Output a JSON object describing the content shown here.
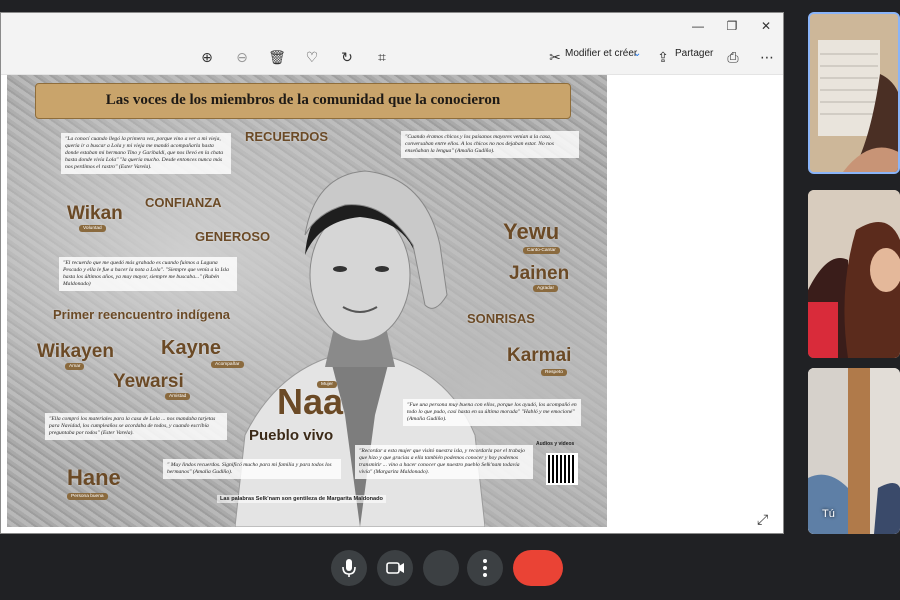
{
  "toolbar": {
    "edit_label": "Modifier et créer",
    "share_label": "Partager"
  },
  "poster": {
    "title": "Las voces de los miembros de la comunidad que la conocieron",
    "words": {
      "recuerdos": "RECUERDOS",
      "confianza": "CONFIANZA",
      "generoso": "GENEROSO",
      "wikan": "Wikan",
      "wikan_tag": "Voluntad",
      "yewu": "Yewu",
      "yewu_tag": "Canto-Cantar",
      "jainen": "Jainen",
      "jainen_tag": "Agradar",
      "primer": "Primer reencuentro indígena",
      "sonrisas": "SONRISAS",
      "wikayen": "Wikayen",
      "wikayen_tag": "Amar",
      "kayne": "Kayne",
      "kayne_tag": "Acompañar",
      "karmai": "Karmai",
      "karmai_tag": "Respeto",
      "yewarsi": "Yewarsi",
      "yewarsi_tag": "Amistad",
      "naa": "Naa",
      "naa_tag": "Mujer",
      "pueblo": "Pueblo vivo",
      "hane": "Hane",
      "hane_tag": "Persona buena"
    },
    "quotes": {
      "q1": "\"La conocí cuando llegó la primera vez, porque vino a ver a mi vieja, quería ir a buscar a Lola y mi vieja me mandó acompañarla hasta donde estaban mi hermano Tino y Garibaldi, que nos llevó en la chata hasta donde vivía Lola\" \"la quería mucho. Desde entonces nunca más nos perdimos el rastro\" (Ester Varela).",
      "q2": "\"Cuando éramos chicos y los paisanos mayores venían a la casa, conversaban entre ellos. A los chicos no nos dejaban estar. No nos enseñaban la lengua\" (Amalia Gudiño).",
      "q3": "\"El recuerdo que me quedó más grabado es cuando fuimos a Laguna Pescado y ella le fue a hacer la nota a Lola\". \"Siempre que venía a la Isla hasta los últimos años, ya muy mayor, siempre me buscaba...\" (Rubén Maldonado)",
      "q4": "\"Fue una persona muy buena con ellos, porque los ayudó, los acompañó en todo lo que pudo, casi hasta en su última morada\" \"Habló y me emocioné\" (Amalia Gudiño).",
      "q5": "\"Ella compró los materiales para la casa de Lola ... nos mandaba tarjetas para Navidad, los cumpleaños se acordaba de todos, y cuando escribía preguntaba por todos\" (Ester Varela).",
      "q6": "\"Recordar a esta mujer que visitó nuestra isla, y recordarla por el trabajo que hizo y que gracias a ella también podemos conocer y hoy podemos transmitir ... vino a hacer conocer que nuestro pueblo Selk'nam todavía vivía\" (Margarita Maldonado).",
      "q7": "\" Muy lindos recuerdos. Significó mucho para mi familia y para todos los hermanos\" (Amalia Gudiño)."
    },
    "qr_label": "Audios y videos",
    "credit": "Las palabras Selk'nam son gentileza de Margarita Maldonado"
  },
  "participants": {
    "self_label": "Tú"
  }
}
